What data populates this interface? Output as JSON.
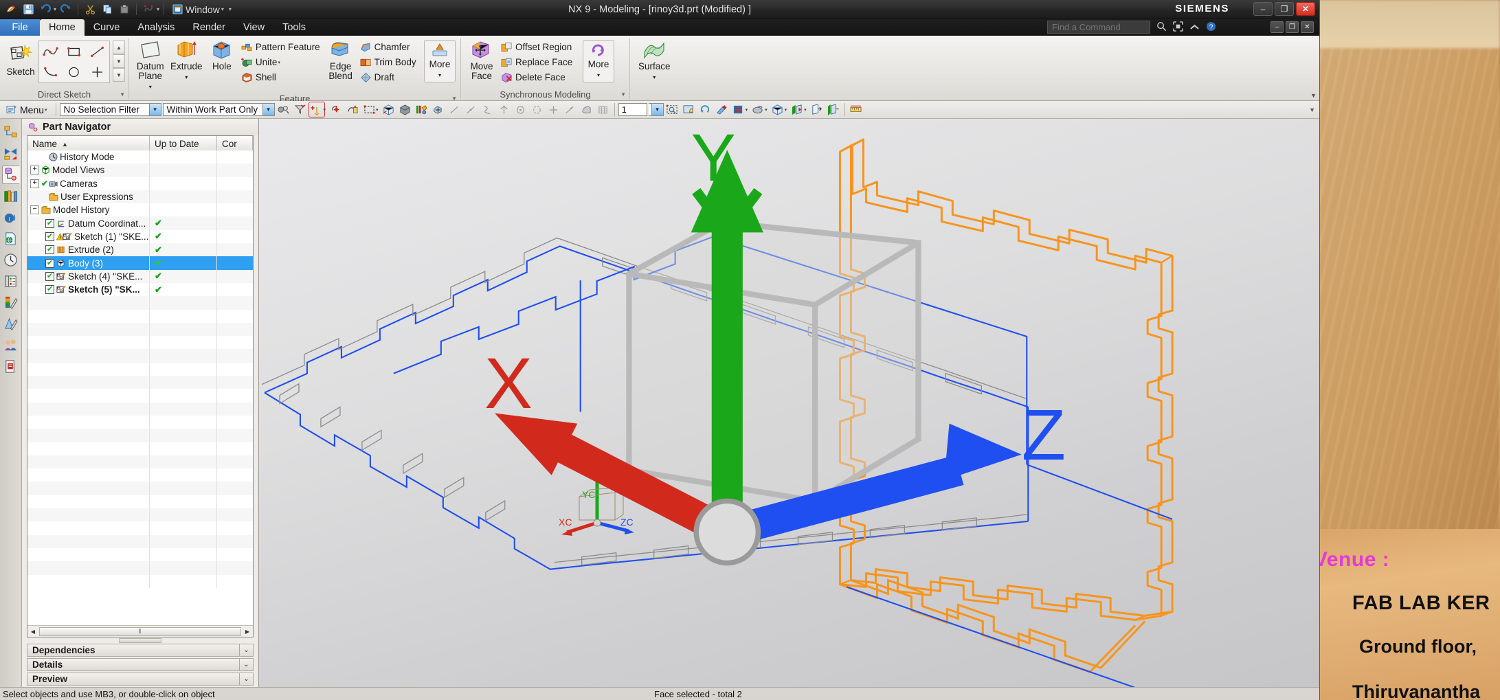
{
  "app": {
    "title": "NX 9 - Modeling - [rinoy3d.prt (Modified) ]",
    "brand": "SIEMENS"
  },
  "quick_access": {
    "items": [
      {
        "name": "nx-logo-icon",
        "label": "NX"
      },
      {
        "name": "save-icon",
        "label": "Save"
      },
      {
        "name": "undo-icon",
        "label": "Undo"
      },
      {
        "name": "redo-icon",
        "label": "Redo"
      },
      {
        "name": "cut-icon",
        "label": "Cut"
      },
      {
        "name": "copy-icon",
        "label": "Copy"
      },
      {
        "name": "paste-icon",
        "label": "Paste"
      },
      {
        "name": "undo-history-icon",
        "label": "Undo List"
      }
    ],
    "window_menu": "Window"
  },
  "window_controls": {
    "minimize": "–",
    "restore": "❐",
    "close": "✕",
    "doc_minimize": "–",
    "doc_restore": "❐",
    "doc_close": "✕"
  },
  "tabs": [
    {
      "label": "File",
      "active": false,
      "is_file": true
    },
    {
      "label": "Home",
      "active": true,
      "is_file": false
    },
    {
      "label": "Curve",
      "active": false,
      "is_file": false
    },
    {
      "label": "Analysis",
      "active": false,
      "is_file": false
    },
    {
      "label": "Render",
      "active": false,
      "is_file": false
    },
    {
      "label": "View",
      "active": false,
      "is_file": false
    },
    {
      "label": "Tools",
      "active": false,
      "is_file": false
    }
  ],
  "search": {
    "placeholder": "Find a Command",
    "icons": [
      "search-icon",
      "command-finder-icon",
      "chevron-up-icon",
      "help-icon"
    ]
  },
  "ribbon": {
    "groups": [
      {
        "name": "direct-sketch",
        "label": "Direct Sketch",
        "big": [
          {
            "label": "Sketch",
            "icon": "sketch-icon",
            "dropdown": false
          }
        ],
        "palette": [
          "profile-icon",
          "rectangle-icon",
          "line-icon",
          "arc-icon",
          "circle-icon",
          "point-icon"
        ],
        "scroll": [
          "▲",
          "▼",
          "▼"
        ]
      },
      {
        "name": "feature",
        "label": "Feature",
        "big": [
          {
            "label": "Datum\nPlane",
            "icon": "datum-plane-icon",
            "dropdown": true
          },
          {
            "label": "Extrude",
            "icon": "extrude-icon",
            "dropdown": true
          },
          {
            "label": "Hole",
            "icon": "hole-icon",
            "dropdown": false
          },
          {
            "label": "Edge\nBlend",
            "icon": "edge-blend-icon",
            "dropdown": false
          },
          {
            "label": "More",
            "icon": "more-feature-icon",
            "dropdown": true
          }
        ],
        "small_col_1": [
          {
            "label": "Pattern Feature",
            "icon": "pattern-feature-icon",
            "dropdown": false
          },
          {
            "label": "Unite",
            "icon": "unite-icon",
            "dropdown": true
          },
          {
            "label": "Shell",
            "icon": "shell-icon",
            "dropdown": false
          }
        ],
        "small_col_2": [
          {
            "label": "Chamfer",
            "icon": "chamfer-icon",
            "dropdown": false
          },
          {
            "label": "Trim Body",
            "icon": "trim-body-icon",
            "dropdown": false
          },
          {
            "label": "Draft",
            "icon": "draft-icon",
            "dropdown": false
          }
        ]
      },
      {
        "name": "synchronous-modeling",
        "label": "Synchronous Modeling",
        "big": [
          {
            "label": "Move\nFace",
            "icon": "move-face-icon",
            "dropdown": false
          },
          {
            "label": "More",
            "icon": "more-sync-icon",
            "dropdown": true
          }
        ],
        "small_col_1": [
          {
            "label": "Offset Region",
            "icon": "offset-region-icon",
            "dropdown": false
          },
          {
            "label": "Replace Face",
            "icon": "replace-face-icon",
            "dropdown": false
          },
          {
            "label": "Delete Face",
            "icon": "delete-face-icon",
            "dropdown": false
          }
        ]
      },
      {
        "name": "surface",
        "label": "",
        "big": [
          {
            "label": "Surface",
            "icon": "surface-icon",
            "dropdown": true
          }
        ]
      }
    ]
  },
  "selection_bar": {
    "menu_label": "Menu",
    "selection_filter": "No Selection Filter",
    "scope": "Within Work Part Only",
    "layer_value": "1",
    "icons_group1": [
      "selection-priority-icon",
      "filter-icon",
      "point-snap-icon",
      "snap-point-icon",
      "face-finder-icon",
      "rectangle-select-icon"
    ],
    "icons_group2": [
      "shaded-edges-icon",
      "solid-body-icon",
      "color-display-icon",
      "move-object-icon"
    ],
    "icons_group3": [
      "endpoint-snap-icon",
      "midpoint-snap-icon",
      "control-point-icon",
      "intersection-icon",
      "arc-center-icon",
      "quadrant-icon",
      "existing-point-icon",
      "point-on-curve-icon",
      "point-on-face-icon",
      "grid-point-icon"
    ],
    "icons_group4": [
      "fit-view-icon",
      "zoom-icon",
      "rotate-icon",
      "pan-icon",
      "style-icon",
      "render-style-icon",
      "view-orient-icon",
      "section-icon",
      "clip-front-icon",
      "clip-back-icon"
    ],
    "icons_group5": [
      "measure-icon"
    ]
  },
  "resource_bar": {
    "items": [
      {
        "name": "assembly-navigator-icon",
        "label": "Assembly Navigator",
        "active": false
      },
      {
        "name": "constraint-navigator-icon",
        "label": "Constraint Navigator",
        "active": false
      },
      {
        "name": "part-navigator-icon",
        "label": "Part Navigator",
        "active": true
      },
      {
        "name": "reuse-library-icon",
        "label": "Reuse Library",
        "active": false
      },
      {
        "name": "hd3d-tools-icon",
        "label": "HD3D Tools",
        "active": false
      },
      {
        "name": "web-browser-icon",
        "label": "Internet Explorer",
        "active": false
      },
      {
        "name": "history-icon",
        "label": "History",
        "active": false
      },
      {
        "name": "process-studio-icon",
        "label": "Process Studio",
        "active": false
      },
      {
        "name": "system-materials-icon",
        "label": "System Materials",
        "active": false
      },
      {
        "name": "system-scene-icon",
        "label": "System Scene",
        "active": false
      },
      {
        "name": "roles-icon",
        "label": "Roles",
        "active": false
      },
      {
        "name": "system-visual-icon",
        "label": "System Visual Reporting",
        "active": false
      }
    ]
  },
  "part_navigator": {
    "title": "Part Navigator",
    "title_icon": "part-navigator-icon",
    "columns": [
      {
        "label": "Name",
        "sort": "▲"
      },
      {
        "label": "Up to Date",
        "sort": ""
      },
      {
        "label": "Cor",
        "sort": ""
      }
    ],
    "rows": [
      {
        "name": "History Mode",
        "indent": 1,
        "expander": "",
        "checkbox": false,
        "icon": "clock-icon",
        "uptodate": "",
        "bold": false,
        "selected": false,
        "warn": false
      },
      {
        "name": "Model Views",
        "indent": 0,
        "expander": "+",
        "checkbox": false,
        "icon": "model-views-icon",
        "uptodate": "",
        "bold": false,
        "selected": false,
        "warn": false
      },
      {
        "name": "Cameras",
        "indent": 0,
        "expander": "+",
        "checkbox": false,
        "icon": "camera-icon",
        "uptodate": "",
        "bold": false,
        "selected": false,
        "warn": false,
        "precheck": true
      },
      {
        "name": "User Expressions",
        "indent": 1,
        "expander": "",
        "checkbox": false,
        "icon": "folder-icon",
        "uptodate": "",
        "bold": false,
        "selected": false,
        "warn": false
      },
      {
        "name": "Model History",
        "indent": 0,
        "expander": "−",
        "checkbox": false,
        "icon": "folder-icon",
        "uptodate": "",
        "bold": false,
        "selected": false,
        "warn": false
      },
      {
        "name": "Datum Coordinat...",
        "indent": 2,
        "expander": "",
        "checkbox": true,
        "icon": "datum-csys-icon",
        "uptodate": "✔",
        "bold": false,
        "selected": false,
        "warn": false
      },
      {
        "name": "Sketch (1) \"SKE...",
        "indent": 2,
        "expander": "",
        "checkbox": true,
        "icon": "sketch-feat-icon",
        "uptodate": "✔",
        "bold": false,
        "selected": false,
        "warn": true
      },
      {
        "name": "Extrude (2)",
        "indent": 2,
        "expander": "",
        "checkbox": true,
        "icon": "extrude-feat-icon",
        "uptodate": "✔",
        "bold": false,
        "selected": false,
        "warn": false
      },
      {
        "name": "Body (3)",
        "indent": 2,
        "expander": "",
        "checkbox": true,
        "icon": "body-feat-icon",
        "uptodate": "✔",
        "bold": false,
        "selected": true,
        "warn": false
      },
      {
        "name": "Sketch (4) \"SKE...",
        "indent": 2,
        "expander": "",
        "checkbox": true,
        "icon": "sketch-feat-icon",
        "uptodate": "✔",
        "bold": false,
        "selected": false,
        "warn": false
      },
      {
        "name": "Sketch (5) \"SK...",
        "indent": 2,
        "expander": "",
        "checkbox": true,
        "icon": "sketch-feat-icon",
        "uptodate": "✔",
        "bold": true,
        "selected": false,
        "warn": false
      }
    ],
    "hscroll": {
      "left": "◀",
      "right": "▶",
      "grip": "⦀"
    },
    "sections": [
      {
        "label": "Dependencies",
        "arrow": "⌄"
      },
      {
        "label": "Details",
        "arrow": "⌄"
      },
      {
        "label": "Preview",
        "arrow": "⌄"
      }
    ]
  },
  "viewport": {
    "triad": {
      "x_label": "X",
      "y_label": "Y",
      "z_label": "Z",
      "x_color": "#e01b1b",
      "y_color": "#1aa81a",
      "z_color": "#1f4ff0"
    },
    "wcs": {
      "x_label": "XC",
      "y_label": "YC",
      "z_label": "ZC"
    },
    "colors": {
      "selected_body": "#f7941e",
      "sketch_curve": "#1f4ff0",
      "hidden_edge": "#8a8a8a",
      "background_top": "#e9e9eb",
      "background_bottom": "#c6c6c8"
    }
  },
  "status": {
    "left": "Select objects and use MB3, or double-click on object",
    "right": "Face selected - total 2"
  },
  "desktop": {
    "poster": {
      "venue_label": "Venue :",
      "line1": "FAB LAB KER",
      "line2": "Ground floor,",
      "line3": "Thiruvanantha",
      "venue_color": "#e23bd2"
    }
  }
}
